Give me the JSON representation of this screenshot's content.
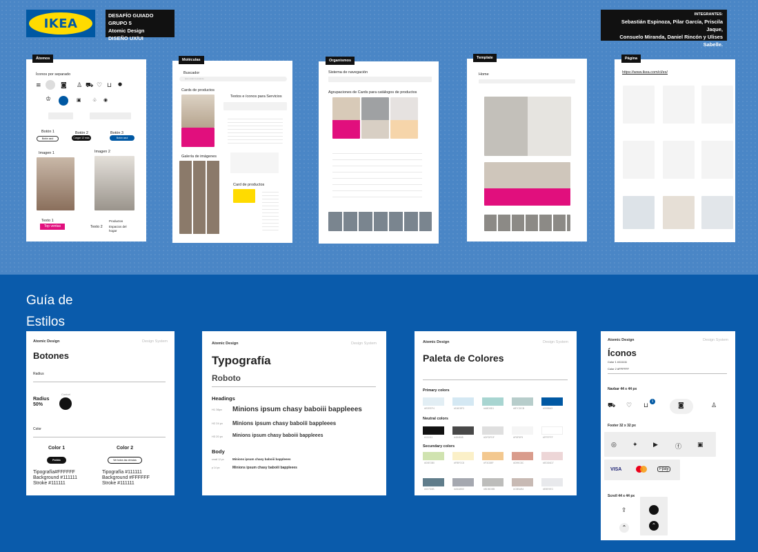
{
  "header": {
    "logo_text": "IKEA",
    "group_title": [
      "DESAFÍO GUIADO GRUPO 5",
      "Atomic Design",
      "DISEÑO UX/UI"
    ],
    "team_label": "INTEGRANTES:",
    "team_names": [
      "Sebastián Espinoza, Pilar García, Priscila Jaque,",
      "Consuelo Miranda, Daniel Rincón y Ulises Sabelle."
    ]
  },
  "stages": {
    "atomos": "Átomos",
    "moleculas": "Moléculas",
    "organismos": "Organismos",
    "template": "Template",
    "pagina": "Página"
  },
  "atomos": {
    "icons_title": "Íconos por separado",
    "boton1": "Botón 1",
    "boton2": "Botón 2",
    "boton3": "Botón 3",
    "b1_text": "Botón azul",
    "b2_text": "Cargar 12 más",
    "b3_text": "Botón azul",
    "imagen1": "Imagen 1",
    "imagen2": "Imagen 2",
    "texto1": "Texto 1",
    "top_ventas": "Top ventas",
    "texto2": "Texto 2",
    "productos": "Productos",
    "espacios": [
      "Espacios del",
      "hogar"
    ]
  },
  "moleculas": {
    "buscador": "Buscador",
    "search_placeholder": "Qué estás buscando",
    "cards": "Cards de productos",
    "textos": "Textos e íconos para Servicios",
    "galeria": "Galería de imágenes",
    "card": "Card de productos"
  },
  "organismos": {
    "nav": "Sistema de navegación",
    "agrup": "Agrupaciones de Cards para catálogos de productos"
  },
  "template": {
    "home": "Home"
  },
  "pagina": {
    "url": "https://www.ikea.com/cl/es/"
  },
  "guide": {
    "title": [
      "Guía de",
      "Estilos"
    ],
    "atomic": "Atomic Design",
    "ds": "Design System",
    "botones": {
      "title": "Botones",
      "radius_label": "Radius",
      "radius_value": "Radius",
      "radius_pct": "50%",
      "radius_note": "Contorl",
      "color_label": "Color",
      "c1": "Color 1",
      "c2": "Color 2",
      "c1_btn": "Pedido",
      "c2_btn": "Ver todos las ciencias",
      "c1_specs": [
        "Tipografía#FFFFFF",
        "Background #111111",
        "Stroke #111111"
      ],
      "c2_specs": [
        "Tipografía #111111",
        "Background #FFFFFF",
        "Stroke #111111"
      ]
    },
    "tipo": {
      "title": "Typografía",
      "font": "Roboto",
      "headings": "Headings",
      "sample": "Minions ipsum chasy baboiii bappleees",
      "sizes": [
        "H1 36px",
        "H2 24 px",
        "H3 20 px"
      ],
      "body": "Body",
      "bsizes": [
        "small 12 px",
        "p 14 px"
      ],
      "bsample": "Minions ipsum chasy baboiii bappleees"
    },
    "paleta": {
      "title": "Paleta de Colores",
      "primary": "Primary colors",
      "neutral": "Neutral colors",
      "secondary": "Secundary colors",
      "primary_colors": [
        "#E2EEF4",
        "#D4E8F3",
        "#A8D5D1",
        "#B7CDCB",
        "#0058A3"
      ],
      "neutral_colors": [
        "#111111",
        "#484848",
        "#DFDFDF",
        "#F5F5F5",
        "#FFFFFF"
      ],
      "secondary_colors": [
        "#D0E3B0",
        "#FBF0C8",
        "#F3C88F",
        "#D99C8C",
        "#EDD6D7",
        "#607D8B",
        "#A5A8B0",
        "#BDBDBB",
        "#C8BAB4",
        "#E8E9EC"
      ]
    },
    "iconos": {
      "title": "Íconos",
      "c1": "Color 1 #111111",
      "c2": "Color 2 #FFFFFF",
      "navbar": "Navbar 44 x 44 px",
      "footer": "Footer 32 x 32 px",
      "scroll": "Scroll 44 x 44 px",
      "cart_count": "1",
      "visa": "VISA",
      "fpay": "Fpay"
    }
  }
}
